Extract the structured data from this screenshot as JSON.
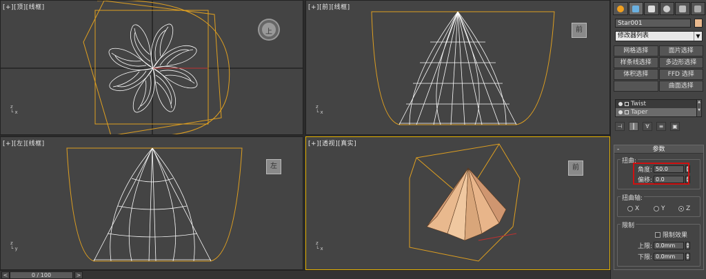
{
  "viewports": {
    "top": {
      "label": "[+][顶][线框]",
      "cube": "上"
    },
    "front": {
      "label": "[+][前][线框]",
      "cube": "前"
    },
    "left": {
      "label": "[+][左][线框]",
      "cube": "左"
    },
    "persp": {
      "label": "[+][透视][真实]",
      "cube": "前"
    }
  },
  "timeline": {
    "prev": "<",
    "next": ">",
    "frame": "0 / 100"
  },
  "panel": {
    "object_name": "Star001",
    "object_color": "#e9b98e",
    "modifier_list": "修改器列表",
    "buttons": [
      "网格选择",
      "面片选择",
      "样条线选择",
      "多边形选择",
      "体积选择",
      "FFD 选择",
      "",
      "曲面选择"
    ],
    "stack": [
      {
        "name": "Twist",
        "selected": false
      },
      {
        "name": "Taper",
        "selected": true
      }
    ],
    "rollout_title": "参数",
    "twist": {
      "group": "扭曲:",
      "angle_label": "角度:",
      "angle_value": "50.0",
      "bias_label": "偏移:",
      "bias_value": "0.0"
    },
    "axis": {
      "group": "扭曲轴:",
      "options": [
        "X",
        "Y",
        "Z"
      ],
      "selected": "Z"
    },
    "limits": {
      "group": "限制",
      "effect_label": "限制效果",
      "upper_label": "上限:",
      "upper_value": "0.0mm",
      "lower_label": "下限:",
      "lower_value": "0.0mm"
    }
  },
  "colors": {
    "accent": "#e8b400",
    "wire": "#ffffff",
    "gizmo": "#e0a020",
    "highlight": "#d01010"
  }
}
